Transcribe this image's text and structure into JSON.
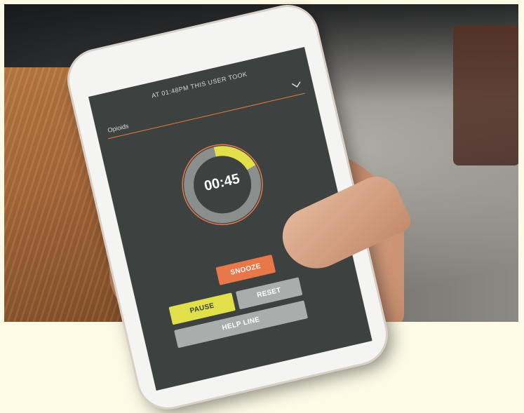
{
  "app": {
    "header": "AT 01:48PM THIS USER TOOK",
    "substance_select": {
      "value": "Opioids"
    },
    "timer": {
      "display": "00:45",
      "progress": 0.2
    },
    "buttons": {
      "snooze": "SNOOZE",
      "pause": "PAUSE",
      "reset": "RESET",
      "help_line": "HELP LINE"
    }
  },
  "colors": {
    "screen_bg": "#3d4140",
    "accent_orange": "#e8774a",
    "accent_yellow": "#e1e04a",
    "neutral_button": "#a9adab",
    "ring_track": "#8a8f8d"
  },
  "icons": {
    "dropdown": "chevron-down-icon"
  }
}
